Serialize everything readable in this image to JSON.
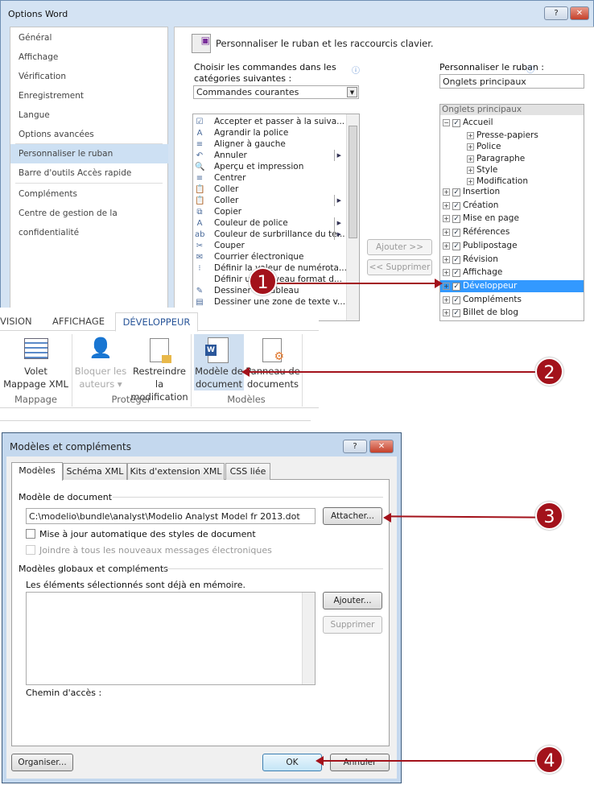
{
  "options_word": {
    "title": "Options Word",
    "help": "?",
    "close": "✕",
    "nav": [
      "Général",
      "Affichage",
      "Vérification",
      "Enregistrement",
      "Langue",
      "Options avancées",
      "Personnaliser le ruban",
      "Barre d'outils Accès rapide",
      "Compléments",
      "Centre de gestion de la confidentialité"
    ],
    "selected_nav": "Personnaliser le ruban",
    "heading": "Personnaliser le ruban et les raccourcis clavier.",
    "choose_label_1": "Choisir les commandes dans les",
    "choose_label_2": "catégories suivantes :",
    "choose_value": "Commandes courantes",
    "ribbon_label": "Personnaliser le ruban :",
    "ribbon_value": "Onglets principaux",
    "commands": [
      {
        "label": "Accepter et passer à la suiva...",
        "icon": "☑",
        "sub": false
      },
      {
        "label": "Agrandir la police",
        "icon": "A",
        "sub": false
      },
      {
        "label": "Aligner à gauche",
        "icon": "≡",
        "sub": false
      },
      {
        "label": "Annuler",
        "icon": "↶",
        "sub": true
      },
      {
        "label": "Aperçu et impression",
        "icon": "🔍",
        "sub": false
      },
      {
        "label": "Centrer",
        "icon": "≡",
        "sub": false
      },
      {
        "label": "Coller",
        "icon": "📋",
        "sub": false
      },
      {
        "label": "Coller",
        "icon": "📋",
        "sub": true
      },
      {
        "label": "Copier",
        "icon": "⧉",
        "sub": false
      },
      {
        "label": "Couleur de police",
        "icon": "A",
        "sub": true
      },
      {
        "label": "Couleur de surbrillance du te...",
        "icon": "ab",
        "sub": true
      },
      {
        "label": "Couper",
        "icon": "✂",
        "sub": false
      },
      {
        "label": "Courrier électronique",
        "icon": "✉",
        "sub": false
      },
      {
        "label": "Définir la valeur de numérota...",
        "icon": "⁝",
        "sub": false
      },
      {
        "label": "Définir un nouveau format d...",
        "icon": "",
        "sub": false
      },
      {
        "label": "Dessiner un tableau",
        "icon": "✎",
        "sub": false
      },
      {
        "label": "Dessiner une zone de texte v...",
        "icon": "▤",
        "sub": false
      }
    ],
    "add_button": "Ajouter >>",
    "remove_button": "<< Supprimer",
    "tree_header": "Onglets principaux",
    "tree": [
      {
        "label": "Accueil",
        "level": 0,
        "expanded": true,
        "checked": true
      },
      {
        "label": "Presse-papiers",
        "level": 1
      },
      {
        "label": "Police",
        "level": 1
      },
      {
        "label": "Paragraphe",
        "level": 1
      },
      {
        "label": "Style",
        "level": 1
      },
      {
        "label": "Modification",
        "level": 1
      },
      {
        "label": "Insertion",
        "level": 0,
        "checked": true
      },
      {
        "label": "Création",
        "level": 0,
        "checked": true
      },
      {
        "label": "Mise en page",
        "level": 0,
        "checked": true
      },
      {
        "label": "Références",
        "level": 0,
        "checked": true
      },
      {
        "label": "Publipostage",
        "level": 0,
        "checked": true
      },
      {
        "label": "Révision",
        "level": 0,
        "checked": true
      },
      {
        "label": "Affichage",
        "level": 0,
        "checked": true
      },
      {
        "label": "Développeur",
        "level": 0,
        "checked": true,
        "selected": true
      },
      {
        "label": "Compléments",
        "level": 0,
        "checked": true
      },
      {
        "label": "Billet de blog",
        "level": 0,
        "checked": true
      }
    ]
  },
  "ribbon": {
    "tabs": [
      "VISION",
      "AFFICHAGE",
      "DÉVELOPPEUR"
    ],
    "active_tab": "DÉVELOPPEUR",
    "buttons": [
      {
        "l1": "Volet",
        "l2": "Mappage XML",
        "icon": "xml-mapping-icon"
      },
      {
        "l1": "Bloquer les",
        "l2": "auteurs ▾",
        "icon": "block-authors-icon",
        "disabled": true
      },
      {
        "l1": "Restreindre la",
        "l2": "modification",
        "icon": "restrict-editing-icon"
      },
      {
        "l1": "Modèle de",
        "l2": "document",
        "icon": "word-template-icon",
        "selected": true
      },
      {
        "l1": "Panneau de",
        "l2": "documents",
        "icon": "document-panel-icon"
      }
    ],
    "groups": [
      "Mappage",
      "Protéger",
      "Modèles"
    ]
  },
  "dialog": {
    "title": "Modèles et compléments",
    "help": "?",
    "close": "✕",
    "tabs": [
      "Modèles",
      "Schéma XML",
      "Kits d'extension XML",
      "CSS liée"
    ],
    "section1": "Modèle de document",
    "template_path": "C:\\modelio\\bundle\\analyst\\Modelio Analyst Model fr 2013.dot",
    "attach": "Attacher...",
    "auto_update": "Mise à jour automatique des styles de document",
    "attach_email": "Joindre à tous les nouveaux messages électroniques",
    "section2": "Modèles globaux et compléments",
    "loaded_note": "Les éléments sélectionnés sont déjà en mémoire.",
    "add": "Ajouter...",
    "remove": "Supprimer",
    "path_label": "Chemin d'accès :",
    "organize": "Organiser...",
    "ok": "OK",
    "cancel": "Annuler"
  },
  "callouts": [
    "1",
    "2",
    "3",
    "4"
  ],
  "colors": {
    "callout": "#a3121b",
    "selection": "#3399ff",
    "nav_selected": "#cde0f3"
  }
}
